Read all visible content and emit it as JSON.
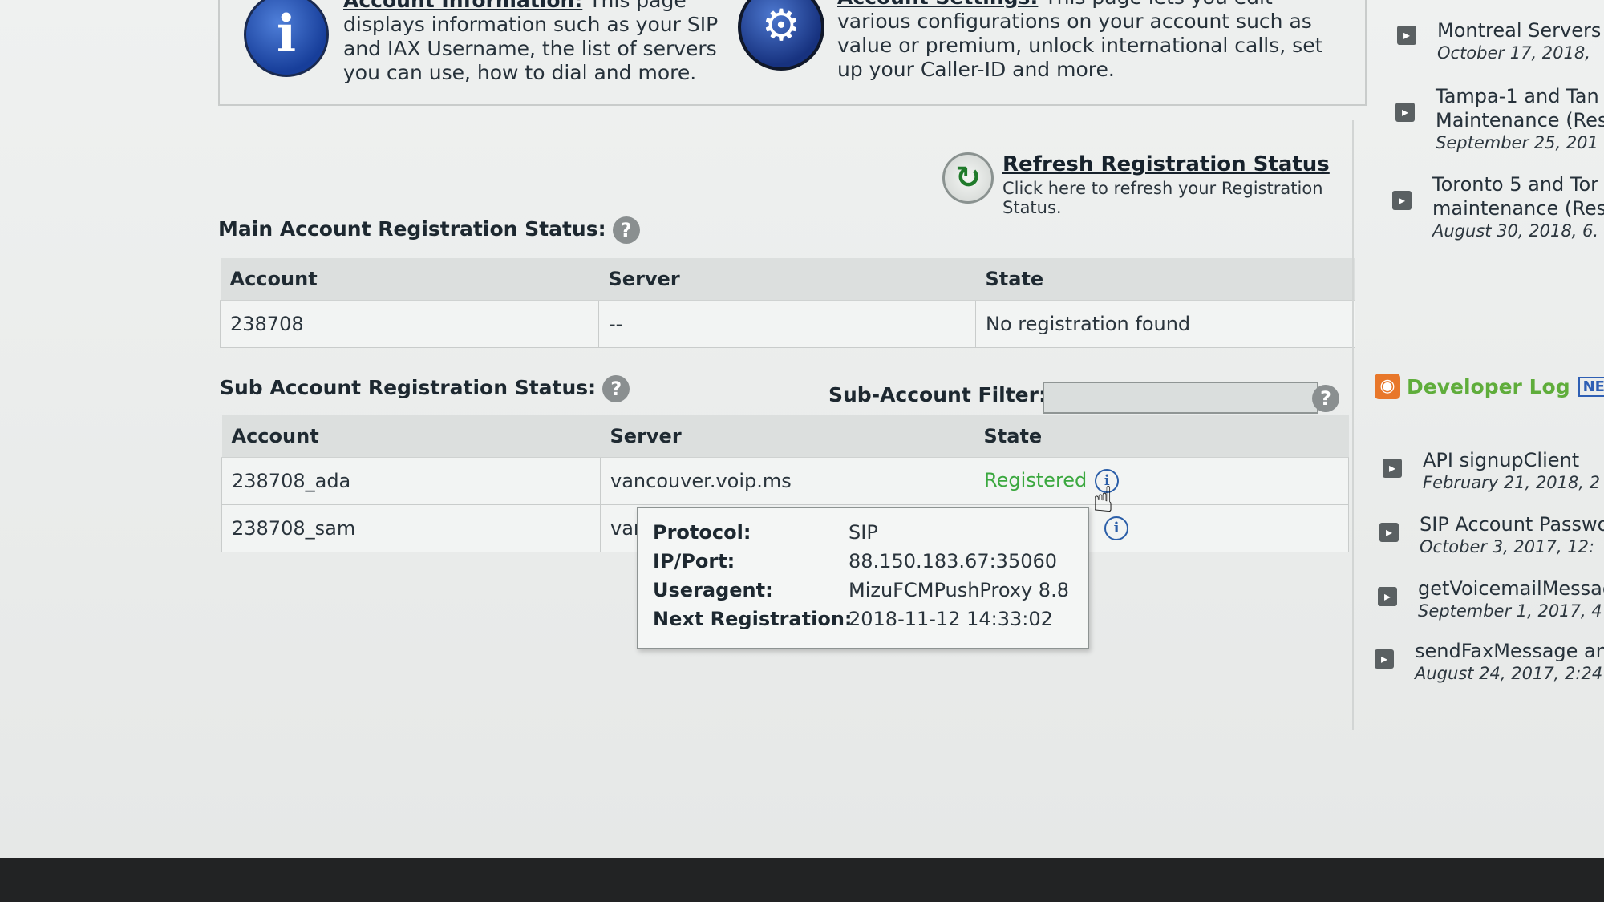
{
  "info": {
    "account_info_title": "Account Information:",
    "account_info_desc": " This page displays information such as your SIP and IAX Username, the list of servers you can use, how to dial and more.",
    "account_settings_title": "Account Settings:",
    "account_settings_desc": " This page lets you edit various configurations on your account such as value or premium, unlock international calls, set up your Caller-ID and more."
  },
  "refresh": {
    "title": "Refresh Registration Status",
    "desc": "Click here to refresh your Registration Status."
  },
  "main_account": {
    "title": "Main Account Registration Status:",
    "headers": [
      "Account",
      "Server",
      "State"
    ],
    "rows": [
      {
        "account": "238708",
        "server": "--",
        "state": "No registration found"
      }
    ]
  },
  "sub_account": {
    "title": "Sub Account Registration Status:",
    "filter_label": "Sub-Account Filter:",
    "filter_value": "",
    "headers": [
      "Account",
      "Server",
      "State"
    ],
    "rows": [
      {
        "account": "238708_ada",
        "server": "vancouver.voip.ms",
        "state": "Registered"
      },
      {
        "account": "238708_sam",
        "server": "var",
        "state": ""
      }
    ]
  },
  "tooltip": {
    "protocol_label": "Protocol:",
    "protocol": "SIP",
    "ipport_label": "IP/Port:",
    "ipport": "88.150.183.67:35060",
    "useragent_label": "Useragent:",
    "useragent": "MizuFCMPushProxy 8.8",
    "nextreg_label": "Next Registration:",
    "nextreg": "2018-11-12 14:33:02"
  },
  "news": [
    {
      "title": "Montreal Servers",
      "date": "October 17, 2018,"
    },
    {
      "title": "Tampa-1 and Tan",
      "title2": "Maintenance (Res",
      "date": "September 25, 201"
    },
    {
      "title": "Toronto 5 and Tor",
      "title2": "maintenance (Res",
      "date": "August 30, 2018, 6."
    }
  ],
  "developer_log": {
    "label": "Developer Log",
    "badge": "NE",
    "items": [
      {
        "title": "API signupClient",
        "date": "February 21, 2018, 2"
      },
      {
        "title": "SIP Account Passwo",
        "date": "October 3, 2017, 12:"
      },
      {
        "title": "getVoicemailMessag",
        "date": "September 1, 2017, 4"
      },
      {
        "title": "sendFaxMessage an",
        "date": "August 24, 2017, 2:24"
      }
    ]
  },
  "icons": {
    "info": "info-icon",
    "gear": "gear-icon",
    "refresh": "refresh-icon",
    "help": "help-icon",
    "detail": "info-circle-icon",
    "rss": "rss-icon",
    "arrow": "arrow-right-icon"
  }
}
